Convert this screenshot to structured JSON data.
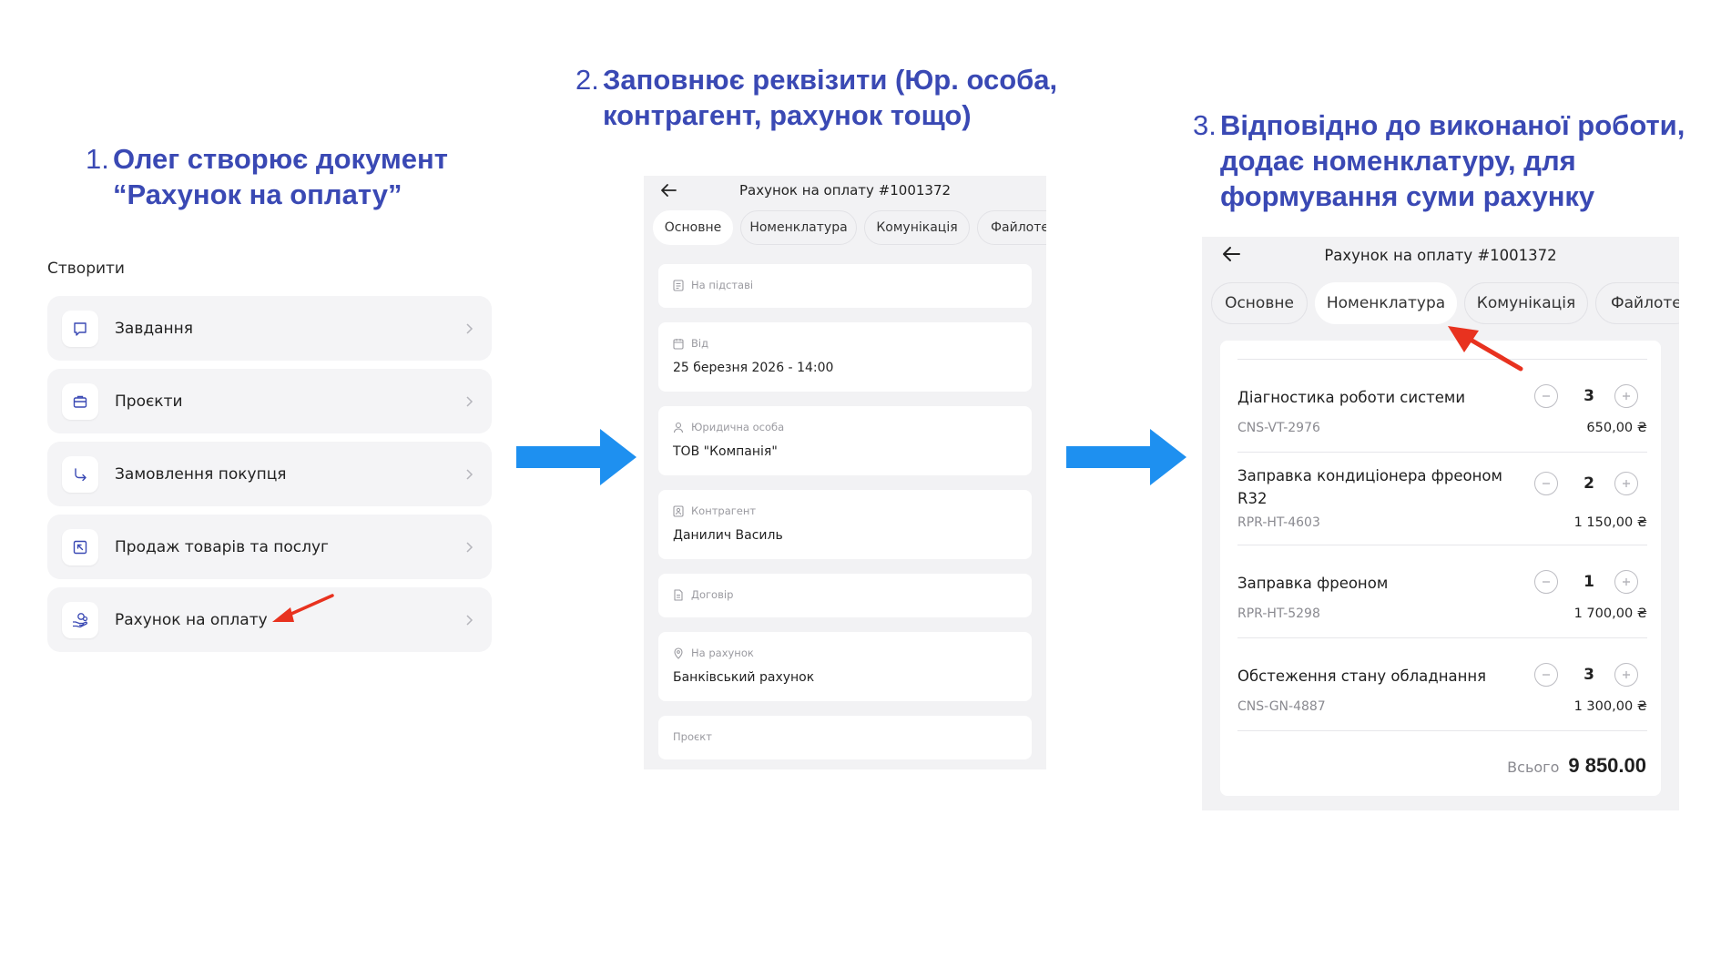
{
  "steps": [
    {
      "num": "1.",
      "lines": [
        "Олег створює документ",
        "“Рахунок на оплату”"
      ]
    },
    {
      "num": "2.",
      "lines": [
        "Заповнює реквізити (Юр. особа,",
        "контрагент, рахунок тощо)"
      ]
    },
    {
      "num": "3.",
      "lines": [
        "Відповідно до виконаної роботи,",
        "додає номенклатуру, для",
        "формування суми рахунку"
      ]
    }
  ],
  "create_menu": {
    "label": "Створити",
    "items": [
      {
        "label": "Завдання",
        "icon": "task-icon"
      },
      {
        "label": "Проєкти",
        "icon": "briefcase-icon"
      },
      {
        "label": "Замовлення покупця",
        "icon": "arrow-turn-icon"
      },
      {
        "label": "Продаж товарів та послуг",
        "icon": "sale-icon"
      },
      {
        "label": "Рахунок на оплату",
        "icon": "invoice-hand-icon"
      }
    ]
  },
  "invoice": {
    "title": "Рахунок на оплату #1001372",
    "tabs": [
      "Основне",
      "Номенклатура",
      "Комунікація",
      "Файлоте"
    ]
  },
  "form": {
    "basis_caption": "На підставі",
    "from_caption": "Від",
    "from_value": "25 березня 2026 - 14:00",
    "legal_caption": "Юридична особа",
    "legal_value": "ТОВ \"Компанія\"",
    "contractor_caption": "Контрагент",
    "contractor_value": "Данилич Василь",
    "contract_caption": "Договір",
    "account_caption": "На рахунок",
    "account_value": "Банківський рахунок",
    "project_caption": "Проєкт"
  },
  "nomenclature": {
    "items": [
      {
        "name": "Діагностика роботи системи",
        "code": "CNS-VT-2976",
        "qty": "3",
        "price": "650,00 ₴"
      },
      {
        "name": "Заправка кондиціонера фреоном R32",
        "code": "RPR-HT-4603",
        "qty": "2",
        "price": "1 150,00 ₴"
      },
      {
        "name": "Заправка фреоном",
        "code": "RPR-HT-5298",
        "qty": "1",
        "price": "1 700,00 ₴"
      },
      {
        "name": "Обстеження стану обладнання",
        "code": "CNS-GN-4887",
        "qty": "3",
        "price": "1 300,00 ₴"
      }
    ],
    "total_label": "Всього",
    "total_value": "9 850.00"
  },
  "colors": {
    "step_title": "#3a49b4",
    "flow_arrow": "#1e90f0",
    "annotation_arrow": "#e8321f"
  }
}
